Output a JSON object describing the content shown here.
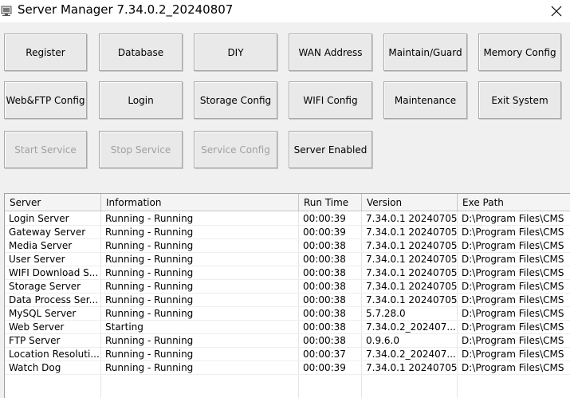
{
  "window": {
    "title": "Server Manager 7.34.0.2_20240807",
    "app_icon": "server-app-icon",
    "close_icon": "close-icon"
  },
  "buttons": {
    "row1": [
      {
        "label": "Register",
        "enabled": true
      },
      {
        "label": "Database",
        "enabled": true
      },
      {
        "label": "DIY",
        "enabled": true
      },
      {
        "label": "WAN Address",
        "enabled": true
      },
      {
        "label": "Maintain/Guard",
        "enabled": true
      },
      {
        "label": "Memory Config",
        "enabled": true
      }
    ],
    "row2": [
      {
        "label": "Web&FTP Config",
        "enabled": true
      },
      {
        "label": "Login",
        "enabled": true
      },
      {
        "label": "Storage Config",
        "enabled": true
      },
      {
        "label": "WIFI Config",
        "enabled": true
      },
      {
        "label": "Maintenance",
        "enabled": true
      },
      {
        "label": "Exit System",
        "enabled": true
      }
    ],
    "row3": [
      {
        "label": "Start Service",
        "enabled": false
      },
      {
        "label": "Stop Service",
        "enabled": false
      },
      {
        "label": "Service Config",
        "enabled": false
      },
      {
        "label": "Server Enabled",
        "enabled": true
      }
    ]
  },
  "table": {
    "columns": [
      "Server",
      "Information",
      "Run Time",
      "Version",
      "Exe Path"
    ],
    "rows": [
      [
        "Login Server",
        "Running - Running",
        "00:00:39",
        "7.34.0.1 20240705",
        "D:\\Program Files\\CMS"
      ],
      [
        "Gateway Server",
        "Running - Running",
        "00:00:39",
        "7.34.0.1 20240705",
        "D:\\Program Files\\CMS"
      ],
      [
        "Media Server",
        "Running - Running",
        "00:00:38",
        "7.34.0.1 20240705",
        "D:\\Program Files\\CMS"
      ],
      [
        "User Server",
        "Running - Running",
        "00:00:38",
        "7.34.0.1 20240705",
        "D:\\Program Files\\CMS"
      ],
      [
        "WIFI Download S...",
        "Running - Running",
        "00:00:38",
        "7.34.0.1 20240705",
        "D:\\Program Files\\CMS"
      ],
      [
        "Storage Server",
        "Running - Running",
        "00:00:38",
        "7.34.0.1 20240705",
        "D:\\Program Files\\CMS"
      ],
      [
        "Data Process Ser...",
        "Running - Running",
        "00:00:38",
        "7.34.0.1 20240705",
        "D:\\Program Files\\CMS"
      ],
      [
        "MySQL Server",
        "Running - Running",
        "00:00:38",
        "5.7.28.0",
        "D:\\Program Files\\CMS"
      ],
      [
        "Web Server",
        "Starting",
        "00:00:38",
        "7.34.0.2_202407...",
        "D:\\Program Files\\CMS"
      ],
      [
        "FTP Server",
        "Running - Running",
        "00:00:38",
        "0.9.6.0",
        "D:\\Program Files\\CMS"
      ],
      [
        "Location Resoluti...",
        "Running - Running",
        "00:00:37",
        "7.34.0.2_202407...",
        "D:\\Program Files\\CMS"
      ],
      [
        "Watch Dog",
        "Running - Running",
        "00:00:39",
        "7.34.0.1 20240705",
        "D:\\Program Files\\CMS"
      ]
    ]
  }
}
